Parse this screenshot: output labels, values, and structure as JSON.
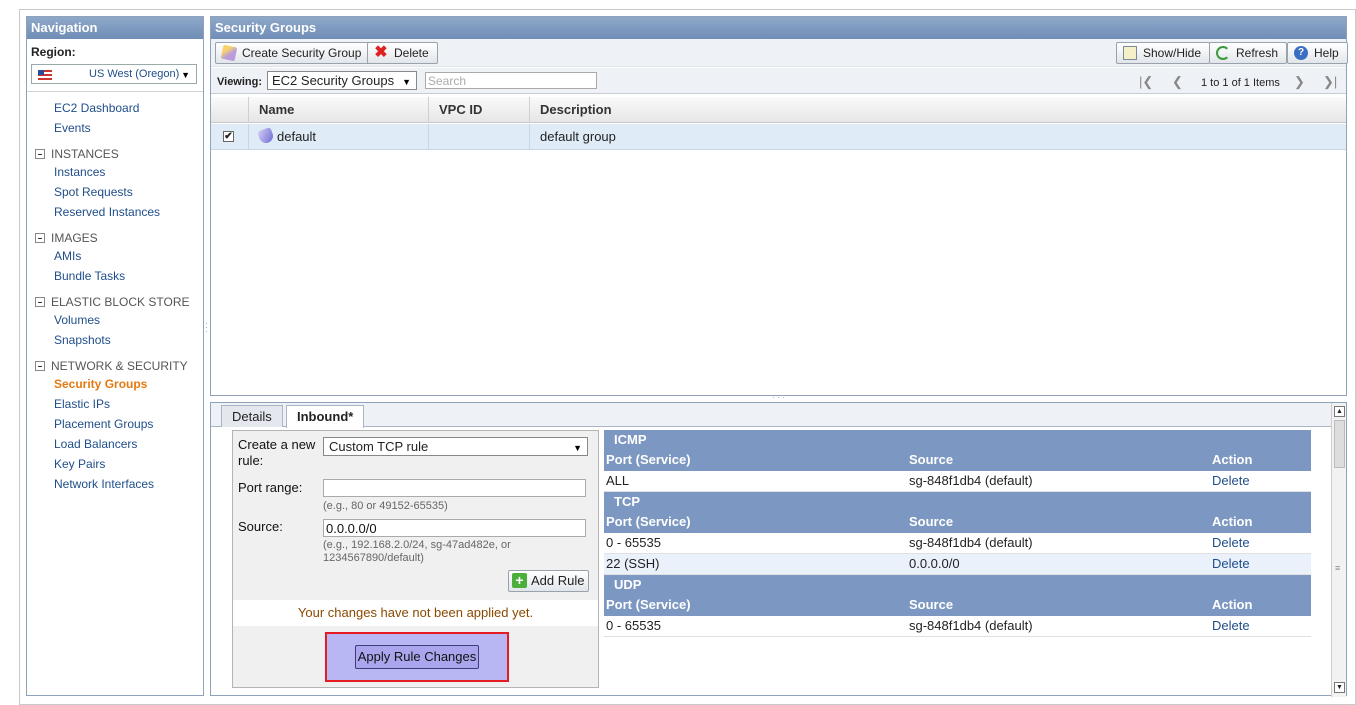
{
  "nav": {
    "title": "Navigation",
    "region_label": "Region:",
    "region_value": "US West (Oregon)",
    "links": {
      "ec2_dashboard": "EC2 Dashboard",
      "events": "Events"
    },
    "sections": [
      {
        "title": "INSTANCES",
        "items": [
          "Instances",
          "Spot Requests",
          "Reserved Instances"
        ]
      },
      {
        "title": "IMAGES",
        "items": [
          "AMIs",
          "Bundle Tasks"
        ]
      },
      {
        "title": "ELASTIC BLOCK STORE",
        "items": [
          "Volumes",
          "Snapshots"
        ]
      },
      {
        "title": "NETWORK & SECURITY",
        "items": [
          "Security Groups",
          "Elastic IPs",
          "Placement Groups",
          "Load Balancers",
          "Key Pairs",
          "Network Interfaces"
        ]
      }
    ],
    "active_item": "Security Groups"
  },
  "main": {
    "title": "Security Groups",
    "toolbar": {
      "create": "Create Security Group",
      "delete": "Delete",
      "show_hide": "Show/Hide",
      "refresh": "Refresh",
      "help": "Help"
    },
    "viewing_label": "Viewing:",
    "viewing_value": "EC2 Security Groups",
    "search_placeholder": "Search",
    "pager_text": "1 to 1 of 1 Items",
    "columns": [
      "Name",
      "VPC ID",
      "Description"
    ],
    "rows": [
      {
        "checked": "✔",
        "name": "default",
        "vpc_id": "",
        "description": "default group"
      }
    ]
  },
  "detail": {
    "tabs": [
      "Details",
      "Inbound*"
    ],
    "active_tab": "Inbound*",
    "form": {
      "create_label": "Create a new rule:",
      "rule_value": "Custom TCP rule",
      "port_label": "Port range:",
      "port_value": "",
      "port_hint": "(e.g., 80 or 49152-65535)",
      "source_label": "Source:",
      "source_value": "0.0.0.0/0",
      "source_hint": "(e.g., 192.168.2.0/24, sg-47ad482e, or 1234567890/default)",
      "add_rule": "Add Rule",
      "notice": "Your changes have not been applied yet.",
      "apply": "Apply Rule Changes"
    },
    "rules": {
      "col_port": "Port (Service)",
      "col_source": "Source",
      "col_action": "Action",
      "groups": [
        {
          "protocol": "ICMP",
          "rows": [
            {
              "port": "ALL",
              "source": "sg-848f1db4 (default)",
              "action": "Delete"
            }
          ]
        },
        {
          "protocol": "TCP",
          "rows": [
            {
              "port": "0 - 65535",
              "source": "sg-848f1db4 (default)",
              "action": "Delete"
            },
            {
              "port": "22 (SSH)",
              "source": "0.0.0.0/0",
              "action": "Delete"
            }
          ]
        },
        {
          "protocol": "UDP",
          "rows": [
            {
              "port": "0 - 65535",
              "source": "sg-848f1db4 (default)",
              "action": "Delete"
            }
          ]
        }
      ]
    }
  },
  "colors": {
    "header": "#7c97c1",
    "link": "#1f4e8a",
    "active": "#e47911",
    "highlight_border": "#e41b23",
    "apply_bg": "#b9b6f4"
  }
}
